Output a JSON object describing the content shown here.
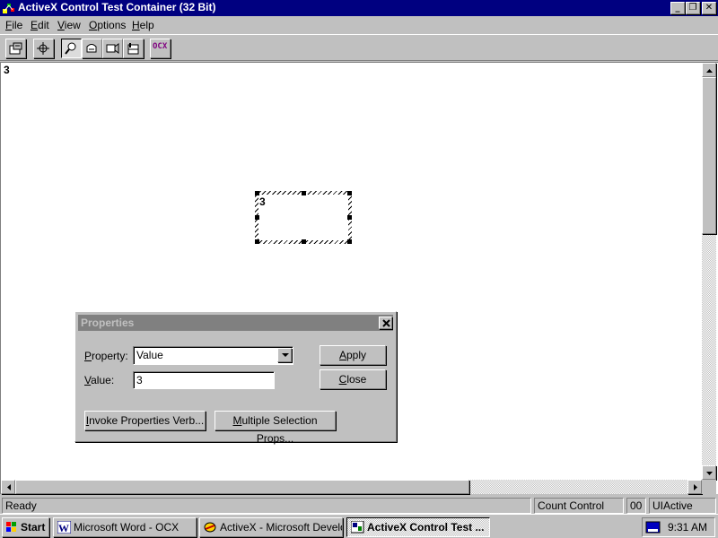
{
  "window": {
    "title": "ActiveX Control Test Container (32 Bit)"
  },
  "menu": [
    {
      "pre": "",
      "u": "F",
      "post": "ile"
    },
    {
      "pre": "",
      "u": "E",
      "post": "dit"
    },
    {
      "pre": "",
      "u": "V",
      "post": "iew"
    },
    {
      "pre": "",
      "u": "O",
      "post": "ptions"
    },
    {
      "pre": "",
      "u": "H",
      "post": "elp"
    }
  ],
  "toolbar": {
    "ocx_label": "OCX"
  },
  "client": {
    "top_text": "3",
    "control_text": "3"
  },
  "properties": {
    "title": "Properties",
    "property_label": {
      "pre": "",
      "u": "P",
      "post": "roperty:"
    },
    "property_value": "Value",
    "value_label": {
      "pre": "",
      "u": "V",
      "post": "alue:"
    },
    "value_value": "3",
    "apply": {
      "pre": "",
      "u": "A",
      "post": "pply"
    },
    "close": {
      "pre": "",
      "u": "C",
      "post": "lose"
    },
    "invoke": {
      "pre": "",
      "u": "I",
      "post": "nvoke Properties Verb..."
    },
    "multiple": {
      "pre": "",
      "u": "M",
      "post": "ultiple Selection Props..."
    }
  },
  "status": {
    "ready": "Ready",
    "control": "Count Control",
    "code": "00",
    "state": "UIActive"
  },
  "taskbar": {
    "start": "Start",
    "tasks": [
      "Microsoft Word - OCX",
      "ActiveX - Microsoft Develo...",
      "ActiveX Control Test ..."
    ],
    "clock": "9:31 AM"
  },
  "colors": {
    "titlebar": "#000080",
    "face": "#c0c0c0",
    "inactive_title": "#808080"
  }
}
